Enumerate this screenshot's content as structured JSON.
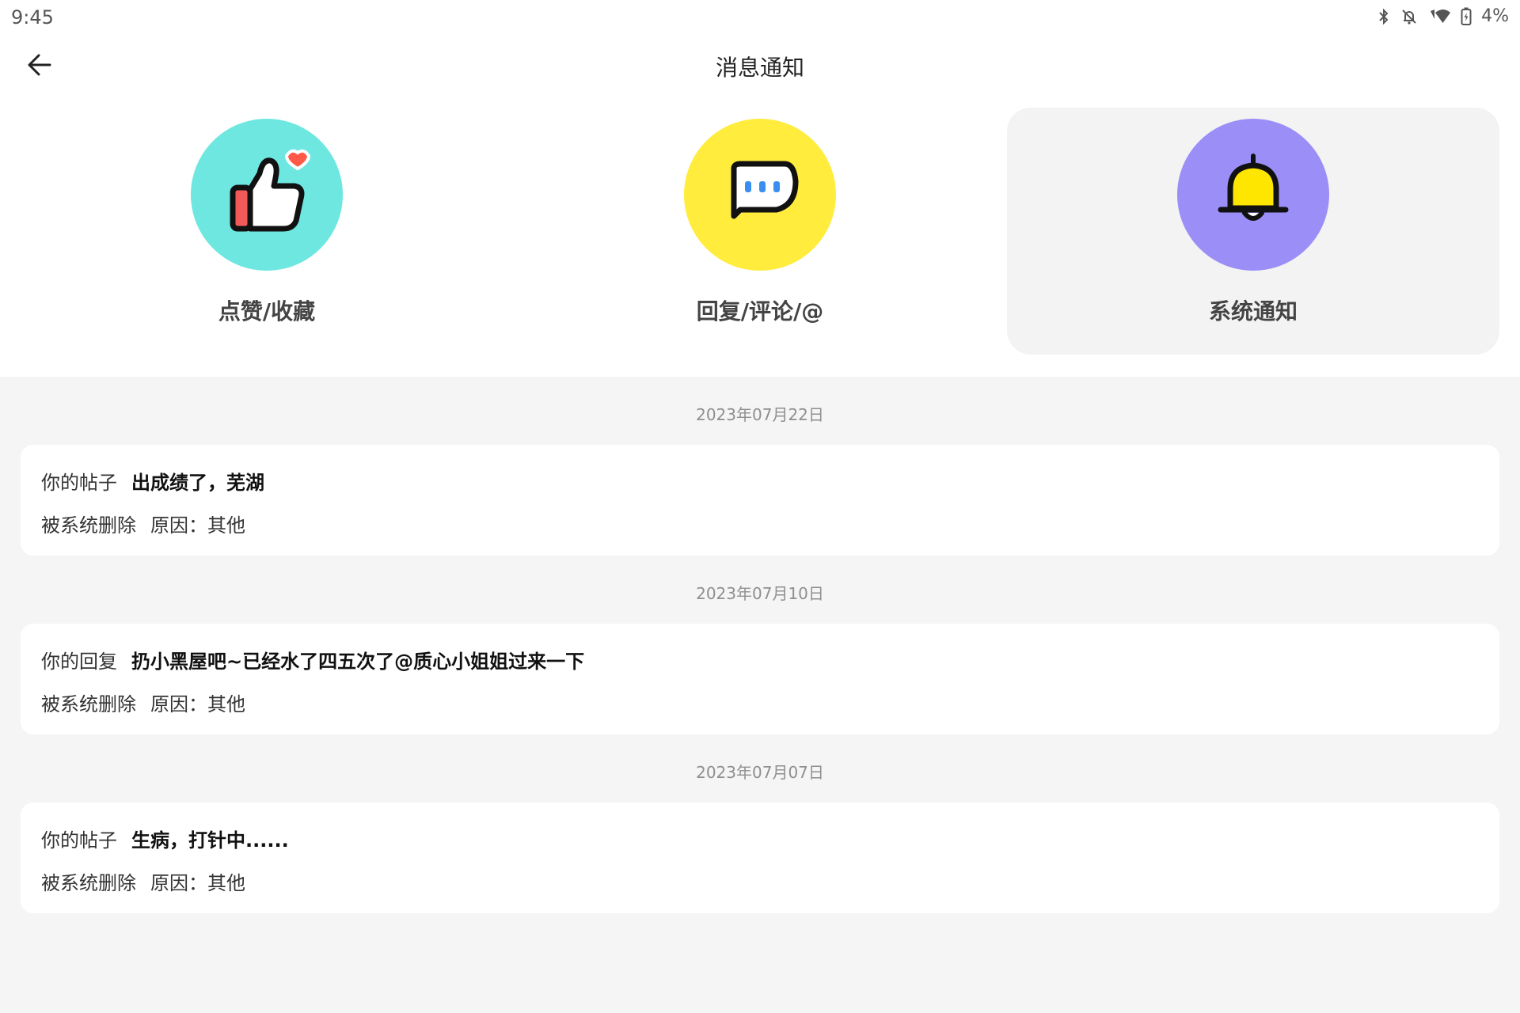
{
  "status_bar": {
    "time": "9:45",
    "battery": "4%",
    "icons": [
      "bluetooth-icon",
      "notifications-off-icon",
      "wifi-icon",
      "battery-charging-icon"
    ]
  },
  "header": {
    "title": "消息通知",
    "back_icon": "arrow-left-icon"
  },
  "categories": [
    {
      "label": "点赞/收藏",
      "icon": "thumbs-up-heart-icon",
      "color": "#6ee7e1",
      "active": false
    },
    {
      "label": "回复/评论/@",
      "icon": "chat-bubble-icon",
      "color": "#ffec3d",
      "active": false
    },
    {
      "label": "系统通知",
      "icon": "bell-icon",
      "color": "#9b8ff7",
      "active": true
    }
  ],
  "notifications": [
    {
      "date": "2023年07月22日",
      "prefix": "你的帖子",
      "title": "出成绩了，芜湖",
      "status": "被系统删除",
      "reason": "原因：其他"
    },
    {
      "date": "2023年07月10日",
      "prefix": "你的回复",
      "title": "扔小黑屋吧~已经水了四五次了@质心小姐姐过来一下",
      "status": "被系统删除",
      "reason": "原因：其他"
    },
    {
      "date": "2023年07月07日",
      "prefix": "你的帖子",
      "title": "生病，打针中......",
      "status": "被系统删除",
      "reason": "原因：其他"
    }
  ]
}
